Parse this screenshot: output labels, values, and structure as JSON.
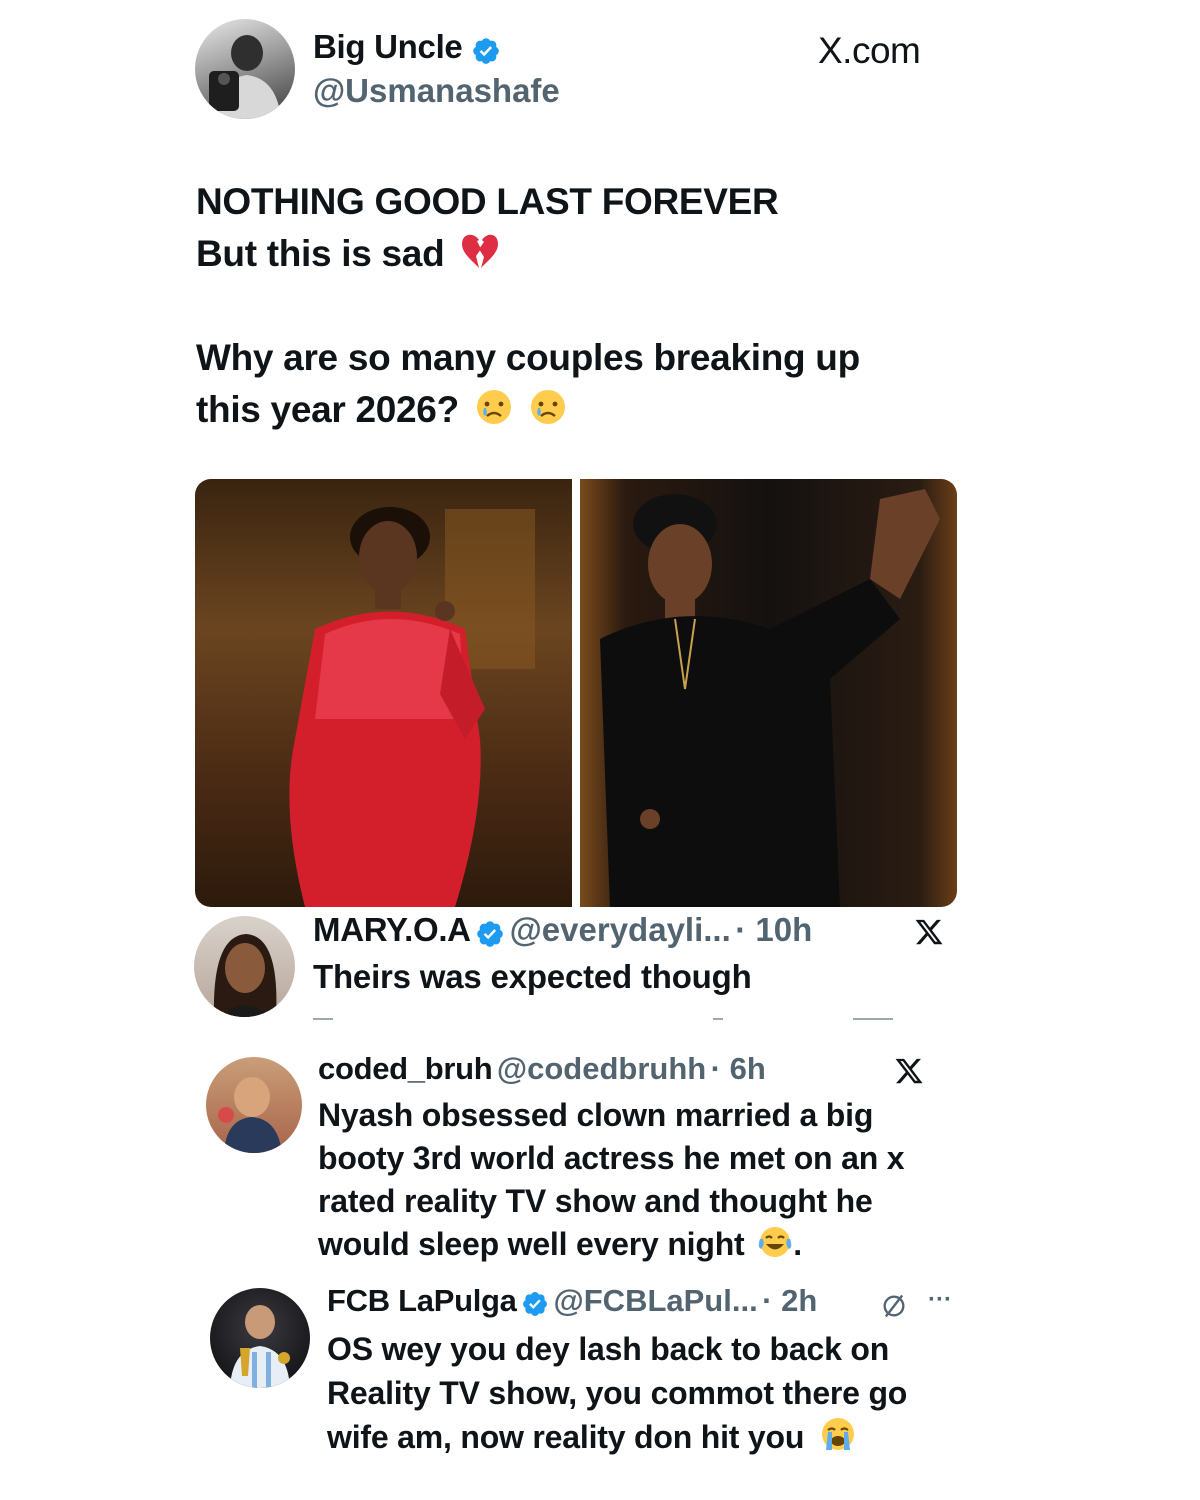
{
  "post": {
    "author_name": "Big Uncle",
    "author_handle": "@Usmanashafe",
    "source": "X.com",
    "line1": "NOTHING GOOD LAST FOREVER",
    "line2": "But this is sad",
    "line3": "Why are so many couples breaking up",
    "line4": "this year 2026?",
    "images": [
      {
        "icon": "woman-red-gown-photo"
      },
      {
        "icon": "man-black-agbada-photo"
      }
    ]
  },
  "replies": [
    {
      "name": "MARY.O.A",
      "verified": true,
      "handle": "@everydayli...",
      "time": "· 10h",
      "text": "Theirs was expected though",
      "icon": "x-logo-icon"
    },
    {
      "name": "coded_bruh",
      "verified": false,
      "handle": "@codedbruhh",
      "time": "· 6h",
      "text1": "Nyash obsessed clown married a big",
      "text2": "booty 3rd world actress he met on an x",
      "text3": "rated reality TV show and thought he",
      "text4": "would sleep well every night",
      "text4_end": ".",
      "icon": "x-logo-icon"
    },
    {
      "name": "FCB LaPulga",
      "verified": true,
      "handle": "@FCBLaPul...",
      "time": "· 2h",
      "more": "···",
      "text1": "OS wey you dey lash back to back on",
      "text2": "Reality TV show, you commot there go",
      "text3": "wife am, now reality don hit you"
    }
  ],
  "colors": {
    "verified": "#1d9bf0",
    "text": "#0f1419",
    "secondary": "#536471"
  }
}
